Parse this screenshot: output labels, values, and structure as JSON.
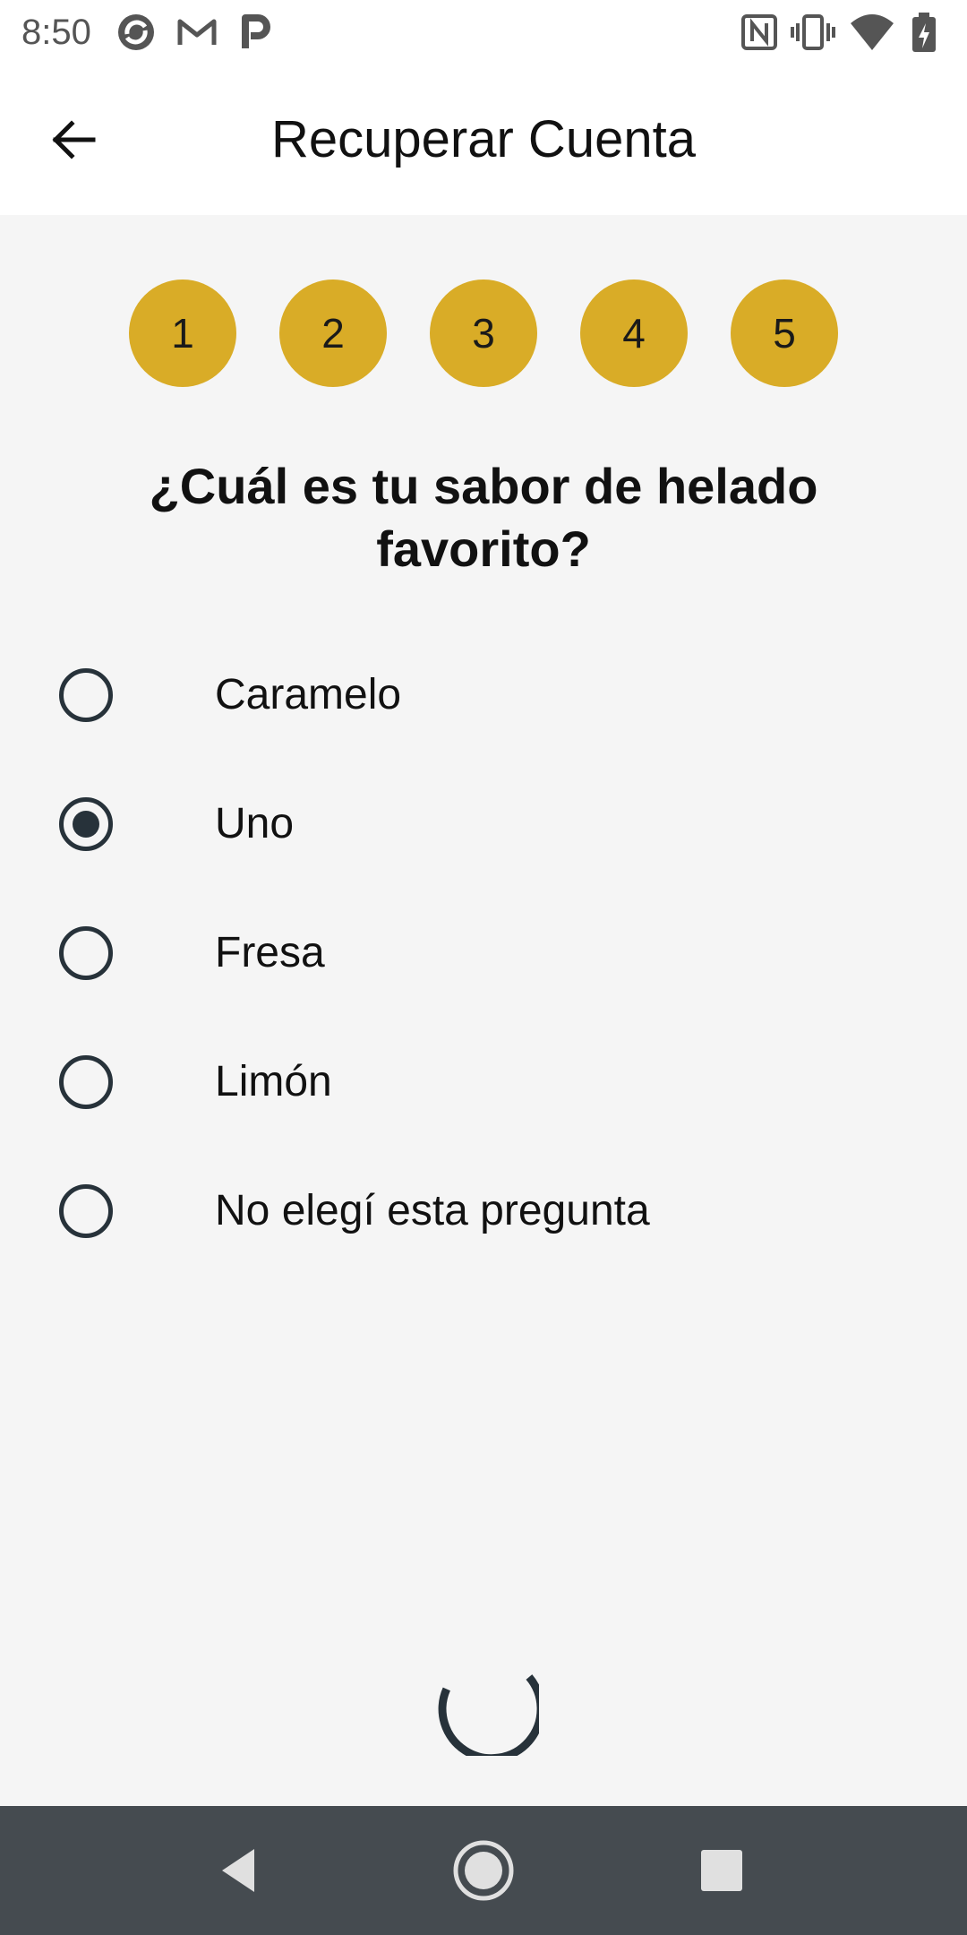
{
  "status_bar": {
    "time": "8:50",
    "left_icons": [
      "sync-icon",
      "gmail-icon",
      "pandora-icon"
    ],
    "right_icons": [
      "nfc-icon",
      "vibrate-icon",
      "wifi-icon",
      "battery-icon"
    ]
  },
  "app_bar": {
    "title": "Recuperar Cuenta",
    "back_icon": "arrow-back-icon"
  },
  "steps": [
    "1",
    "2",
    "3",
    "4",
    "5"
  ],
  "question": "¿Cuál es tu sabor de helado favorito?",
  "options": [
    {
      "label": "Caramelo",
      "selected": false
    },
    {
      "label": "Uno",
      "selected": true
    },
    {
      "label": "Fresa",
      "selected": false
    },
    {
      "label": "Limón",
      "selected": false
    },
    {
      "label": "No elegí esta pregunta",
      "selected": false
    }
  ],
  "loading": true,
  "nav_bar": {
    "buttons": [
      "back-triangle-icon",
      "home-circle-icon",
      "recents-square-icon"
    ]
  },
  "colors": {
    "accent": "#d9ac27",
    "radio": "#27323a",
    "background": "#f5f5f5",
    "nav_bar": "#454b50"
  }
}
